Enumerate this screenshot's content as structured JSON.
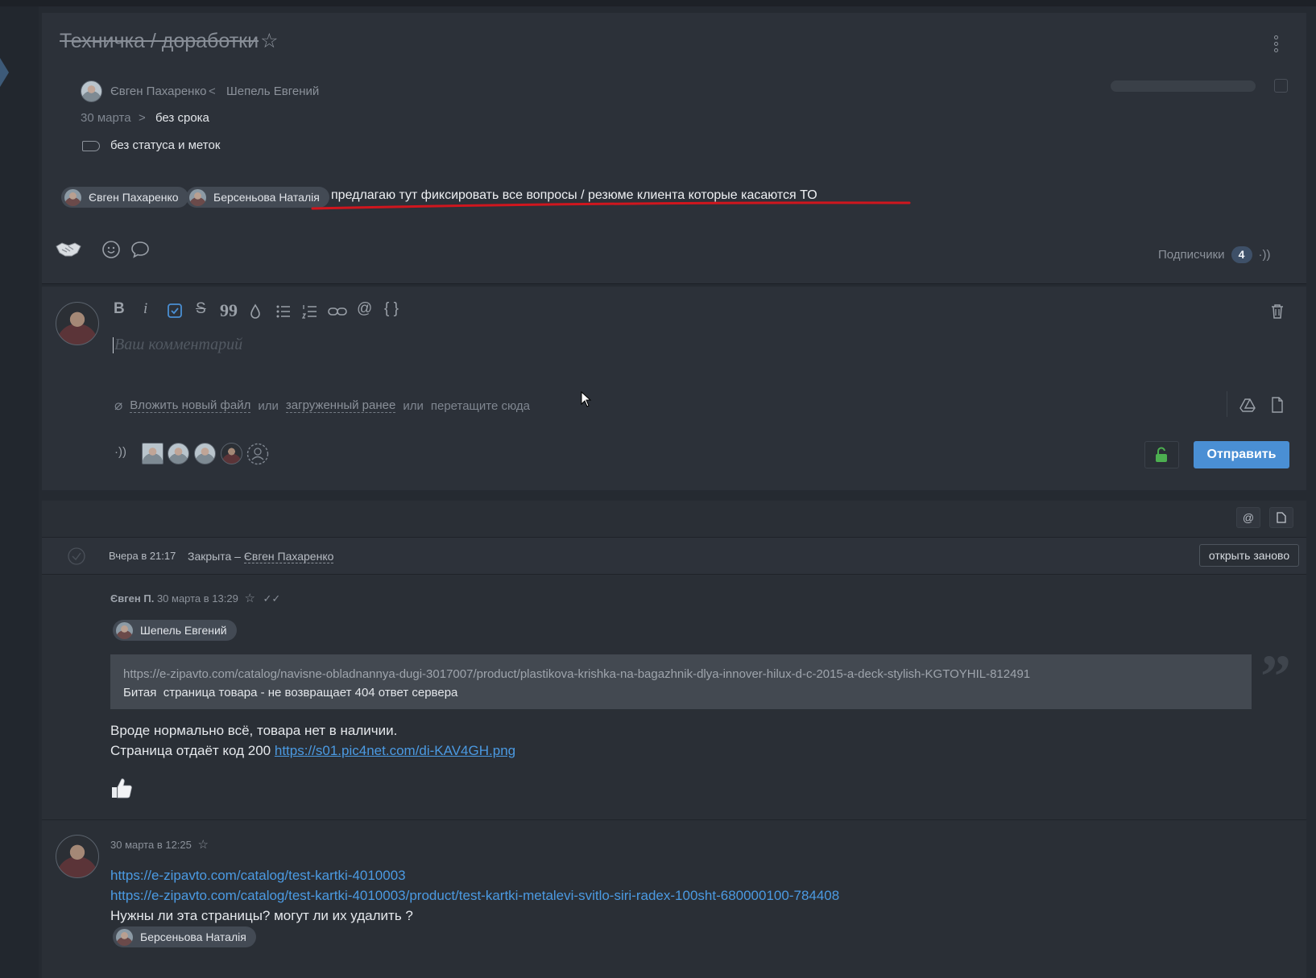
{
  "task": {
    "title": "Техничка / доработки",
    "author": "Євген Пахаренко",
    "assigner": "Шепель Евгений",
    "created": "30 марта",
    "deadline": "без срока",
    "status_text": "без статуса и меток",
    "mentions": [
      "Євген Пахаренко",
      "Берсеньова Наталія"
    ],
    "description": "предлагаю тут фиксировать все вопросы / резюме клиента которые касаются ТО",
    "subscribers_label": "Подписчики",
    "subscribers_count": "4",
    "accent_color": "#4a8fd4",
    "underline_color": "#d0161e"
  },
  "editor": {
    "placeholder": "Ваш комментарий",
    "attach_new": "Вложить новый файл",
    "or1": "или",
    "attach_prev": "загруженный ранее",
    "or2": "или",
    "drag_text": "перетащите сюда",
    "send_label": "Отправить"
  },
  "feed": {
    "header_at": "@",
    "status_time": "Вчера в 21:17",
    "status_text": "Закрыта –",
    "status_user": "Євген Пахаренко",
    "reopen_label": "открыть заново",
    "comments": [
      {
        "author": "Євген П.",
        "time": "30 марта в 13:29",
        "mention": "Шепель Евгений",
        "quote_url": "https://e-zipavto.com/catalog/navisne-obladnannya-dugi-3017007/product/plastikova-krishka-na-bagazhnik-dlya-innover-hilux-d-c-2015-a-deck-stylish-KGTOYHIL-812491",
        "quote_text": "Битая  страница товара - не возвращает 404 ответ сервера",
        "line1": "Вроде нормально всё, товара нет в наличии.",
        "line2": "Страница отдаёт код 200",
        "link": "https://s01.pic4net.com/di-KAV4GH.png"
      },
      {
        "time": "30 марта в 12:25",
        "link1": "https://e-zipavto.com/catalog/test-kartki-4010003",
        "link2": "https://e-zipavto.com/catalog/test-kartki-4010003/product/test-kartki-metalevi-svitlo-siri-radex-100sht-680000100-784408",
        "line": "Нужны ли эта страницы? могут ли их удалить ?",
        "mention": "Берсеньова Наталія"
      }
    ]
  }
}
